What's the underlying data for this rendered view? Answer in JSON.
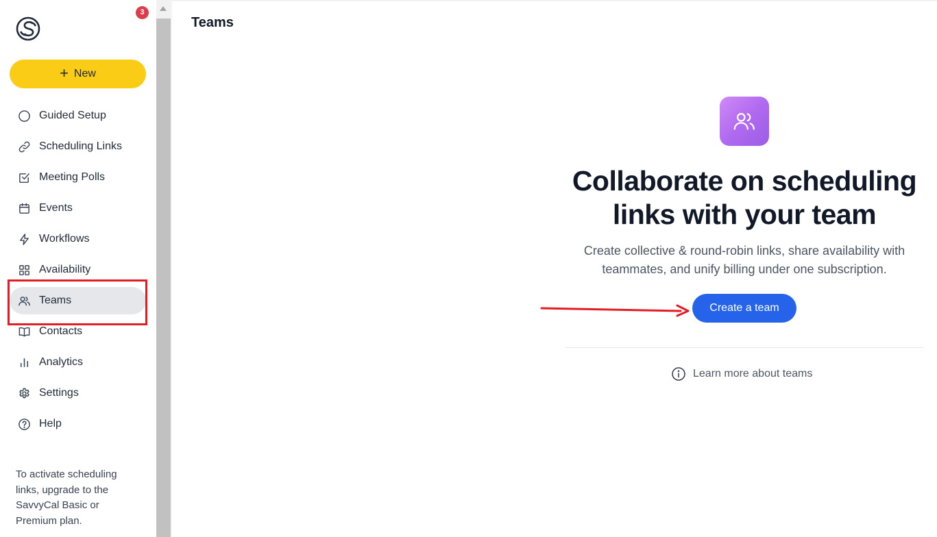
{
  "sidebar": {
    "notification_count": "3",
    "new_button": {
      "label": "New"
    },
    "items": [
      {
        "label": "Guided Setup",
        "icon": "circle-icon"
      },
      {
        "label": "Scheduling Links",
        "icon": "link-icon"
      },
      {
        "label": "Meeting Polls",
        "icon": "checkbox-icon"
      },
      {
        "label": "Events",
        "icon": "calendar-icon"
      },
      {
        "label": "Workflows",
        "icon": "lightning-icon"
      },
      {
        "label": "Availability",
        "icon": "grid-icon"
      },
      {
        "label": "Teams",
        "icon": "users-icon",
        "active": true
      },
      {
        "label": "Contacts",
        "icon": "book-icon"
      },
      {
        "label": "Analytics",
        "icon": "bar-chart-icon"
      },
      {
        "label": "Settings",
        "icon": "gear-icon"
      },
      {
        "label": "Help",
        "icon": "help-circle-icon"
      }
    ],
    "upgrade_note": "To activate scheduling links, upgrade to the SavvyCal Basic or Premium plan."
  },
  "main": {
    "page_title": "Teams",
    "hero": {
      "title": "Collaborate on scheduling links with your team",
      "description": "Create collective & round-robin links, share availability with teammates, and unify billing under one subscription.",
      "cta_label": "Create a team",
      "learn_more": "Learn more about teams"
    }
  },
  "colors": {
    "new_button": "#facc15",
    "cta": "#2563eb",
    "badge": "#dc3d4b",
    "hero_icon_gradient": [
      "#d08af7",
      "#9b5de5"
    ],
    "annotation": "#e31b23"
  }
}
